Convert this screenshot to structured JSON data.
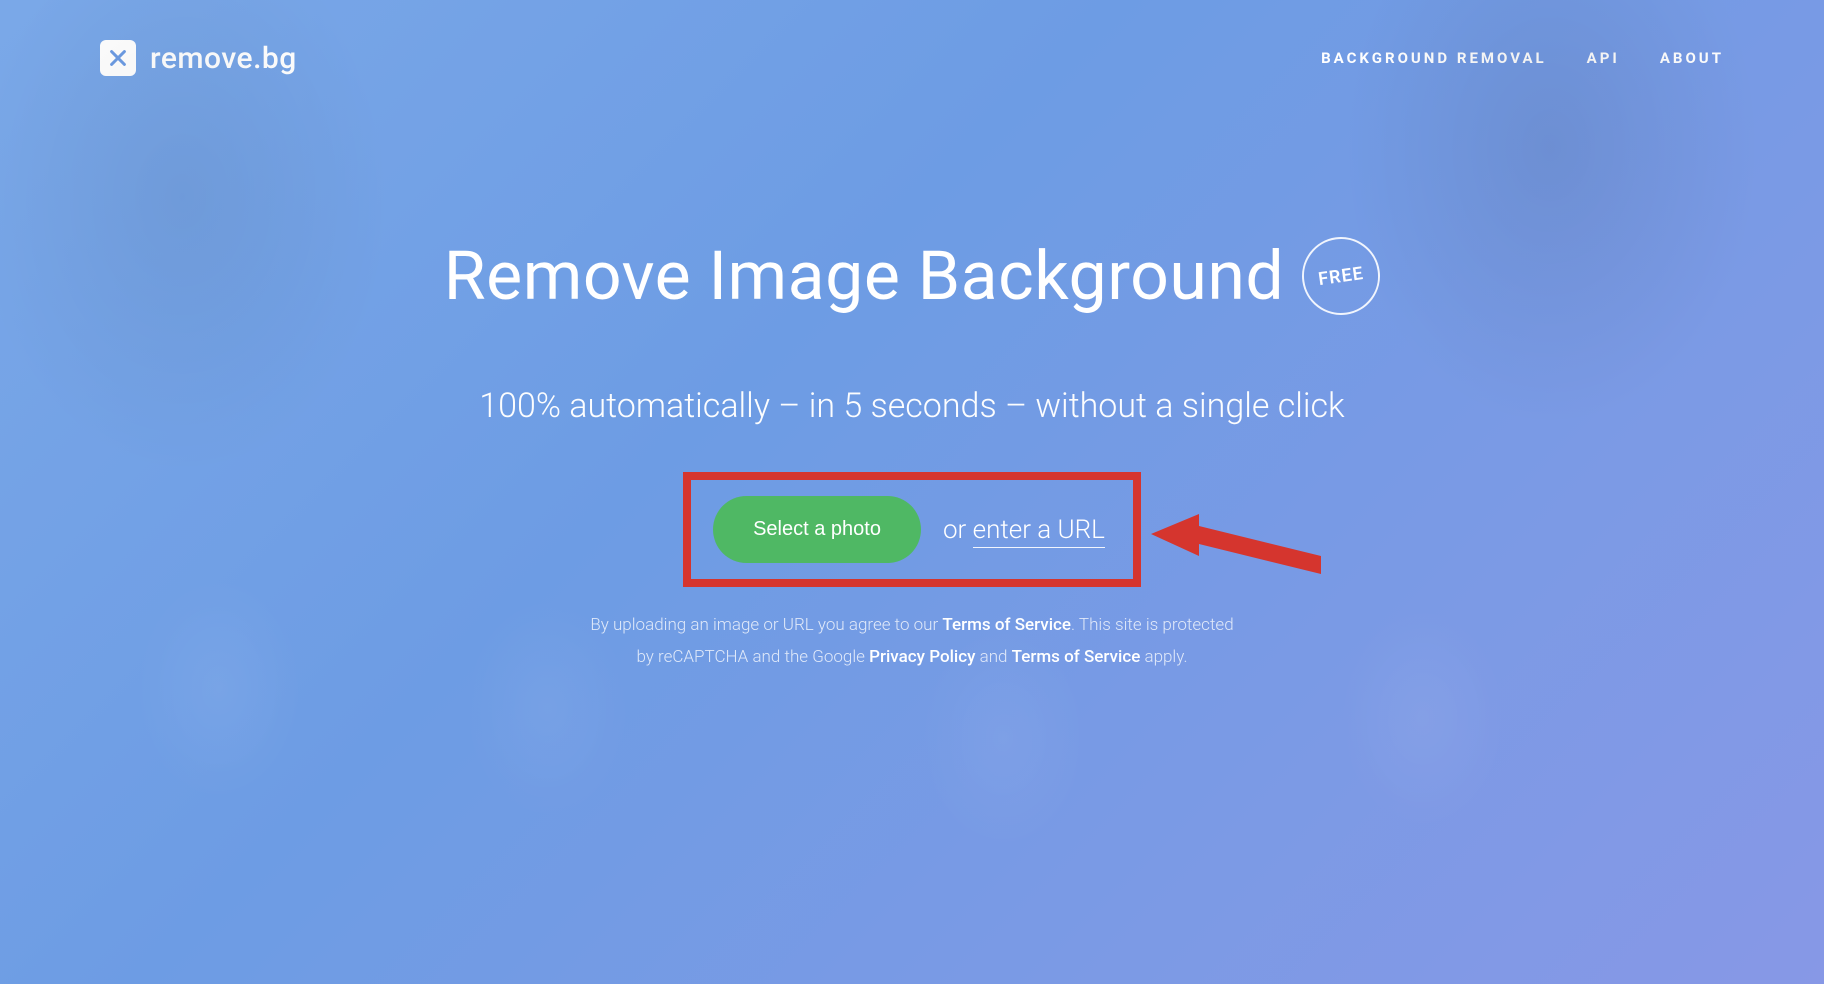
{
  "brand": "remove.bg",
  "nav": {
    "bg_removal": "BACKGROUND REMOVAL",
    "api": "API",
    "about": "ABOUT"
  },
  "hero": {
    "title": "Remove Image Background",
    "badge": "FREE",
    "subtitle": "100% automatically – in 5 seconds – without a single click"
  },
  "cta": {
    "select_label": "Select a photo",
    "or_text": "or ",
    "url_link": "enter a URL"
  },
  "legal": {
    "part1": "By uploading an image or URL you agree to our ",
    "tos1": "Terms of Service",
    "part2": ". This site is protected",
    "part3": "by reCAPTCHA and the Google ",
    "privacy": "Privacy Policy",
    "and": " and ",
    "tos2": "Terms of Service",
    "apply": " apply."
  },
  "annotation": {
    "highlight_color": "#d5352e",
    "arrow_color": "#d5352e"
  }
}
